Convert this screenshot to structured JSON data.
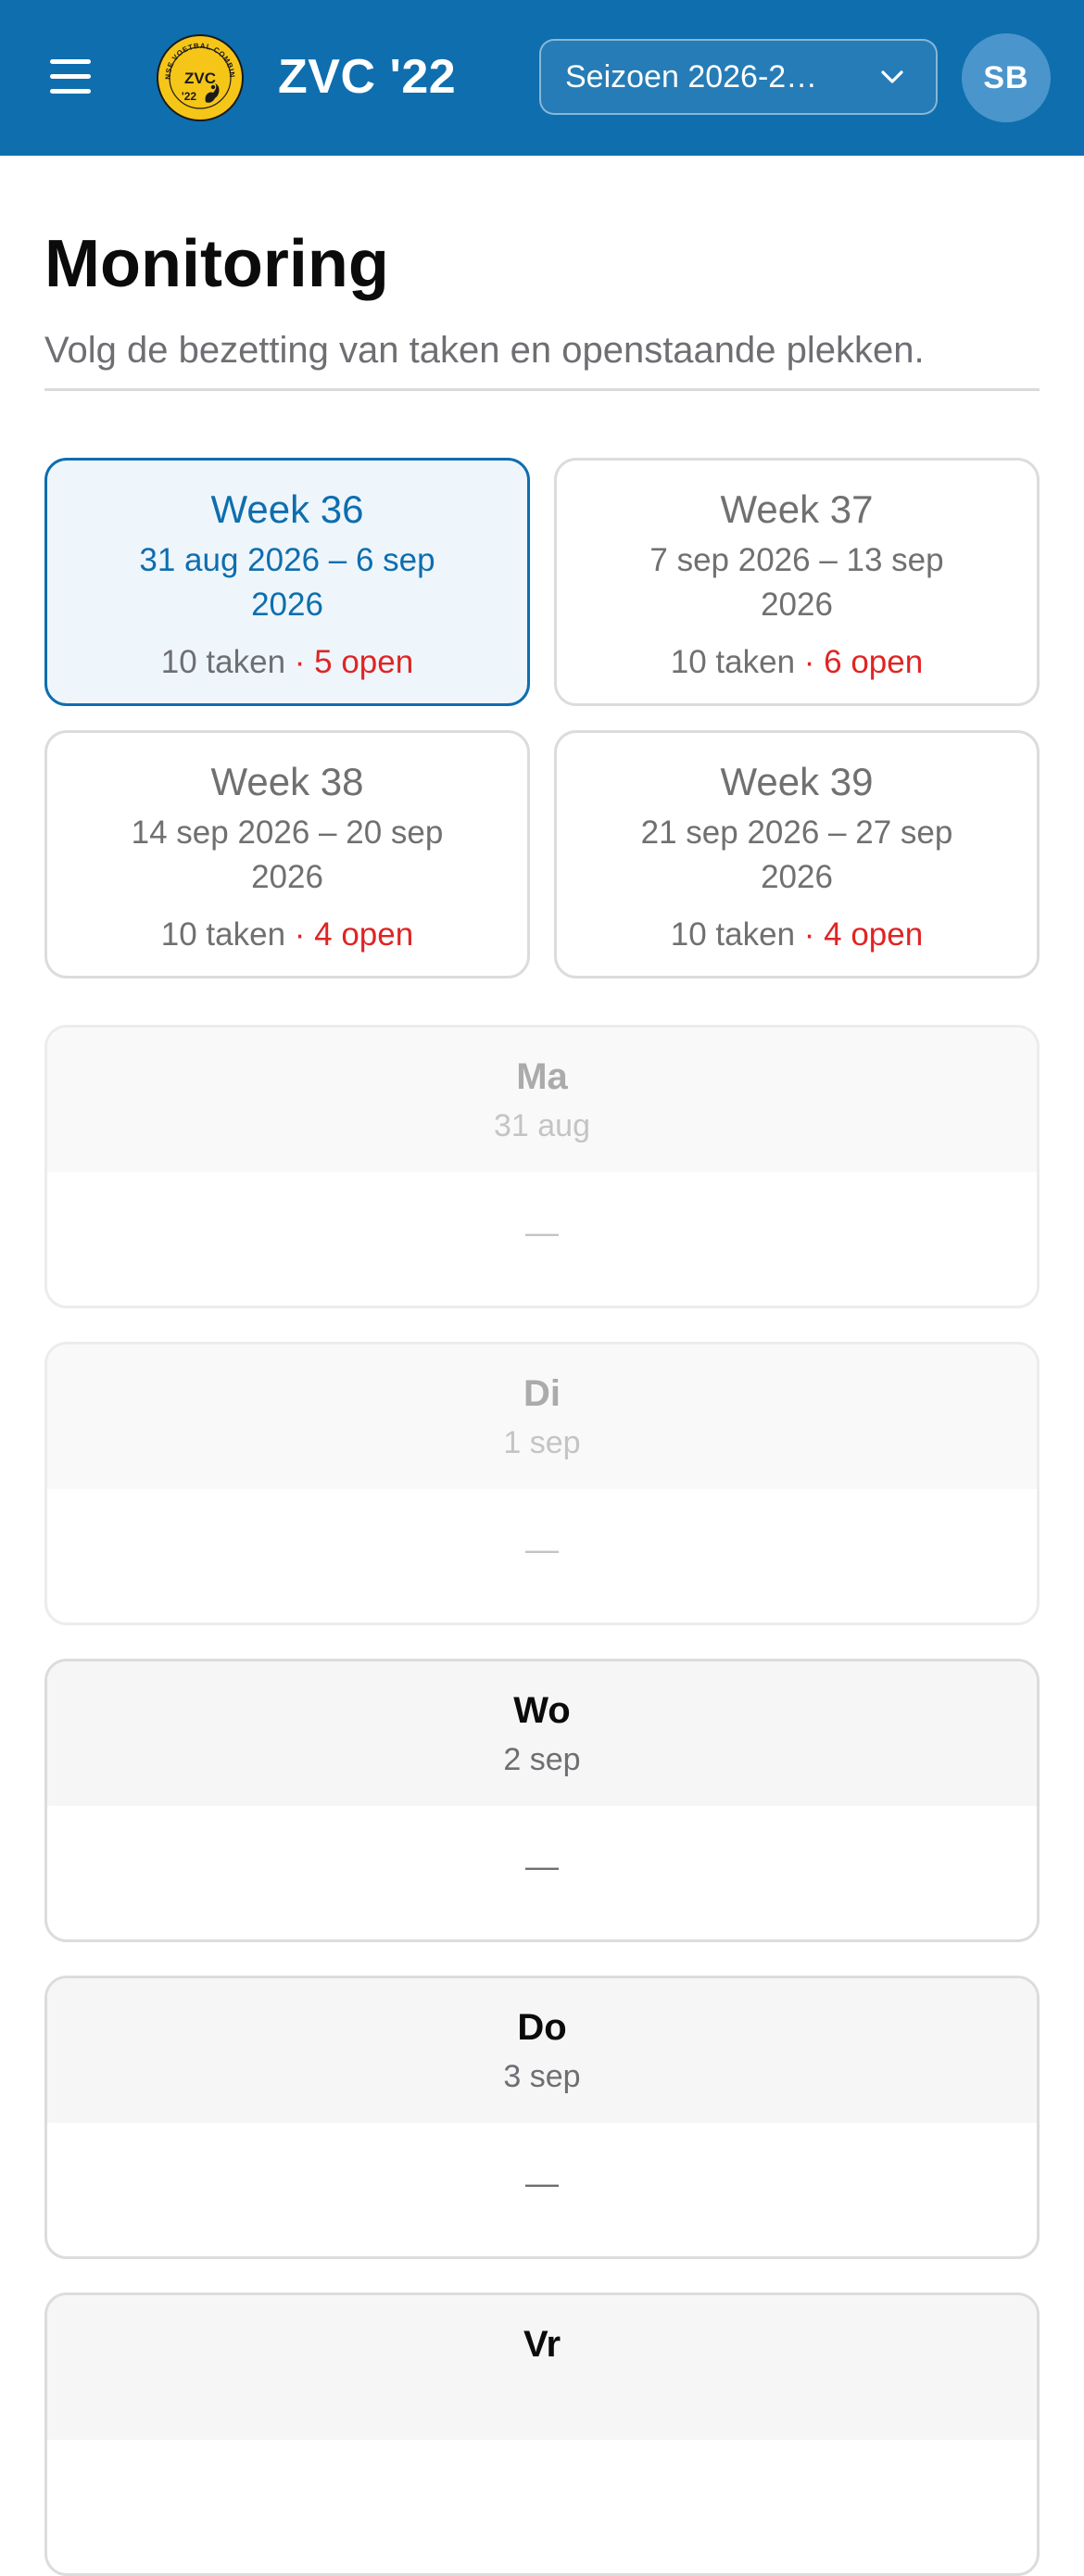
{
  "header": {
    "club_name": "ZVC '22",
    "logo": {
      "icon": "club-crest-icon",
      "ring_text": "ZAANSE VOETBAL COMBINATIE",
      "badge_text": "ZVC",
      "badge_subtext": "'22",
      "primary_color": "#f5c518",
      "ink_color": "#111111"
    },
    "season_select": {
      "value": "Seizoen 2026-2…",
      "icon": "chevron-down-icon"
    },
    "menu_icon": "hamburger-menu-icon",
    "user_initials": "SB",
    "bar_color": "#0e6eae"
  },
  "page": {
    "title": "Monitoring",
    "subtitle": "Volg de bezetting van taken en openstaande plekken."
  },
  "weeks": [
    {
      "title": "Week 36",
      "range": "31 aug 2026 – 6 sep 2026",
      "tasks": "10 taken",
      "separator": " · ",
      "open": "5 open",
      "selected": true
    },
    {
      "title": "Week 37",
      "range": "7 sep 2026 – 13 sep 2026",
      "tasks": "10 taken",
      "separator": " · ",
      "open": "6 open",
      "selected": false
    },
    {
      "title": "Week 38",
      "range": "14 sep 2026 – 20 sep 2026",
      "tasks": "10 taken",
      "separator": " · ",
      "open": "4 open",
      "selected": false
    },
    {
      "title": "Week 39",
      "range": "21 sep 2026 – 27 sep 2026",
      "tasks": "10 taken",
      "separator": " · ",
      "open": "4 open",
      "selected": false
    }
  ],
  "days": [
    {
      "name": "Ma",
      "date": "31 aug",
      "empty": "—",
      "past": true
    },
    {
      "name": "Di",
      "date": "1 sep",
      "empty": "—",
      "past": true
    },
    {
      "name": "Wo",
      "date": "2 sep",
      "empty": "—",
      "past": false
    },
    {
      "name": "Do",
      "date": "3 sep",
      "empty": "—",
      "past": false
    },
    {
      "name": "Vr",
      "date": "",
      "empty": "",
      "past": false
    }
  ],
  "colors": {
    "accent": "#0e6eae",
    "open_red": "#e02424",
    "selected_bg": "#eef6fc",
    "avatar_bg": "#4a95cc"
  }
}
